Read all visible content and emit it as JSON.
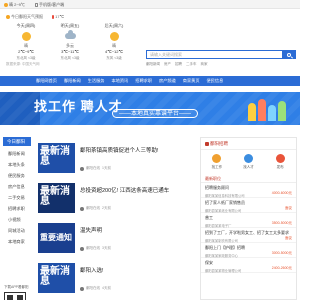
{
  "topbar": {
    "weather_link": "晴 2~9℃",
    "phone_link": "手机版/客户端"
  },
  "weather": {
    "city": "今日鄱阳天气预报",
    "temp_label": "17℃",
    "days": [
      {
        "name": "今天(周四)",
        "condition": "晴",
        "range": "2℃~9℃",
        "wind": "东北风 <3级",
        "icon": "sun-icon"
      },
      {
        "name": "明天(周五)",
        "condition": "多云",
        "range": "3℃~11℃",
        "wind": "东北风 <3级",
        "icon": "cloud-icon"
      },
      {
        "name": "后天(周六)",
        "condition": "晴",
        "range": "4℃~12℃",
        "wind": "东风 <3级",
        "icon": "sun-icon"
      }
    ],
    "footer": "数据来源: 中国天气网"
  },
  "search": {
    "placeholder": "请输入关键词搜索",
    "hot_links": [
      "鄱阳新闻",
      "房产",
      "招聘",
      "二手车",
      "商家"
    ]
  },
  "nav": {
    "items": [
      "鄱阳网首页",
      "鄱阳新闻",
      "生活服务",
      "本地资讯",
      "招聘求职",
      "房产频道",
      "商家黄页",
      "便民信息"
    ]
  },
  "banner": {
    "title": "找工作 聘人才",
    "slogan": "——本地真实靠谱平台——"
  },
  "categories": {
    "head": "今日鄱阳",
    "items": [
      "鄱阳新闻",
      "本地头条",
      "便民服务",
      "房产信息",
      "二手交易",
      "招聘求职",
      "小视频",
      "同城活动",
      "本地商家"
    ],
    "qr_label": "下载APP看鄱阳"
  },
  "news": [
    {
      "thumb": "最新消息",
      "title": "鄱阳茶镇高质镇促进个人三等助!",
      "author": "鄱阳在线",
      "time": "1天前",
      "color": "#1f4fa8"
    },
    {
      "thumb": "最新消息",
      "title": "总投资超200亿! 江西这条高速已通车",
      "author": "鄱阳在线",
      "time": "2天前",
      "color": "#12306b"
    },
    {
      "thumb": "重要通知",
      "title": "温失声明",
      "author": "鄱阳在线",
      "time": "3天前",
      "color": "#1a3f8f"
    },
    {
      "thumb": "最新消息",
      "title": "鄱阳入选!",
      "author": "鄱阳在线",
      "time": "4天前",
      "color": "#1f4fa8"
    }
  ],
  "jobs": {
    "head": "鄱阳招聘",
    "actions": [
      {
        "label": "找工作",
        "color": "#f0a030"
      },
      {
        "label": "找人才",
        "color": "#3b8de0"
      },
      {
        "label": "发布",
        "color": "#e9543a"
      }
    ],
    "sub_head": "最新职位",
    "list": [
      {
        "title": "招聘服务顾问",
        "company": "鄱阳某某信息科技有限公司",
        "salary": "4000-6000元"
      },
      {
        "title": "招了家人纸厂家销售员",
        "company": "鄱阳县某某纸业有限公司",
        "salary": "面议"
      },
      {
        "title": "普工",
        "company": "鄱阳县某某电子厂",
        "salary": "3500-5000元"
      },
      {
        "title": "招到了工厂，开学啦男女工、招了女工太多要求",
        "company": "鄱阳某某制衣有限公司",
        "salary": "面议"
      },
      {
        "title": "鄱阳上门【护理】招聘",
        "company": "鄱阳某某家政服务中心",
        "salary": "3000-5000元"
      },
      {
        "title": "保安",
        "company": "鄱阳县某某物业管理公司",
        "salary": "2400-2600元"
      }
    ]
  }
}
